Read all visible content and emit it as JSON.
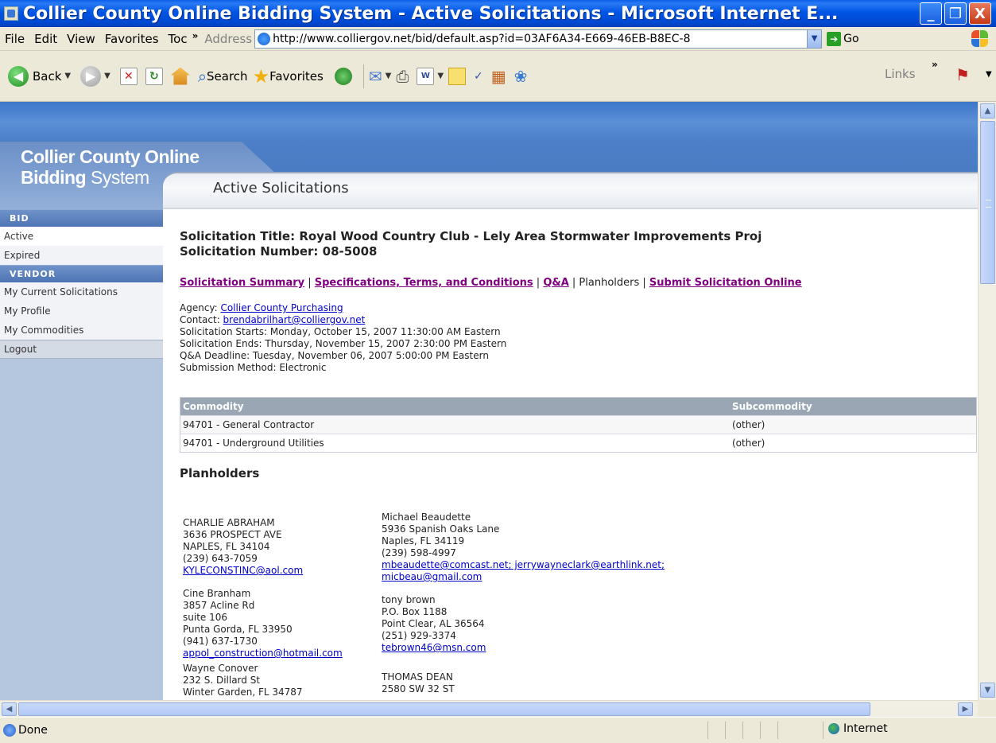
{
  "window": {
    "title": "Collier County Online Bidding System - Active Solicitations - Microsoft Internet E...",
    "min_label": "_",
    "max_label": "❐",
    "close_label": "X"
  },
  "menubar": {
    "items": [
      "File",
      "Edit",
      "View",
      "Favorites",
      "Toc"
    ],
    "chevron": "»",
    "address_label": "Address",
    "address_url": "http://www.colliergov.net/bid/default.asp?id=03AF6A34-E669-46EB-B8EC-8",
    "go_label": "Go"
  },
  "toolbar": {
    "back_label": "Back",
    "search_label": "Search",
    "favorites_label": "Favorites",
    "links_label": "Links",
    "chevron": "»"
  },
  "site": {
    "logo_line1": "Collier County Online",
    "logo_line2_bold": "Bidding",
    "logo_line2_rest": " System",
    "section_title": "Active Solicitations"
  },
  "sidebar": {
    "bid_header": "BID",
    "bid_items": [
      "Active",
      "Expired"
    ],
    "vendor_header": "VENDOR",
    "vendor_items": [
      "My Current Solicitations",
      "My Profile",
      "My Commodities"
    ],
    "logout": "Logout"
  },
  "solicitation": {
    "title_line": "Solicitation Title: Royal Wood Country Club - Lely Area Stormwater Improvements Proj",
    "number_line": "Solicitation Number: 08-5008",
    "nav": {
      "summary": "Solicitation Summary",
      "specs": "Specifications, Terms, and Conditions",
      "qa": "Q&A",
      "planholders": "Planholders",
      "submit": "Submit Solicitation Online",
      "sep": " | "
    },
    "agency_label": "Agency: ",
    "agency": "Collier County Purchasing",
    "contact_label": "Contact: ",
    "contact": "brendabrilhart@colliergov.net",
    "starts": "Solicitation Starts: Monday, October 15, 2007 11:30:00 AM Eastern",
    "ends": "Solicitation Ends: Thursday, November 15, 2007 2:30:00 PM Eastern",
    "qa_deadline": "Q&A Deadline: Tuesday, November 06, 2007 5:00:00 PM Eastern",
    "submission": "Submission Method: Electronic"
  },
  "commodities": {
    "headers": [
      "Commodity",
      "Subcommodity"
    ],
    "rows": [
      [
        "94701 - General Contractor",
        "(other)"
      ],
      [
        "94701 - Underground Utilities",
        "(other)"
      ]
    ]
  },
  "planholders": {
    "heading": "Planholders",
    "col1": [
      {
        "name": "CHARLIE ABRAHAM",
        "addr1": "3636 PROSPECT AVE",
        "addr2": "",
        "city": "NAPLES, FL 34104",
        "phone": "(239) 643-7059",
        "email": "KYLECONSTINC@aol.com"
      },
      {
        "name": "Cine Branham",
        "addr1": "3857 Acline Rd",
        "addr2": "suite 106",
        "city": "Punta Gorda, FL 33950",
        "phone": "(941) 637-1730",
        "email": "appol_construction@hotmail.com"
      },
      {
        "name": "Wayne Conover",
        "addr1": "232 S. Dillard St",
        "addr2": "",
        "city": "Winter Garden, FL 34787",
        "phone": "",
        "email": ""
      }
    ],
    "col2": [
      {
        "name": "Michael Beaudette",
        "addr1": "5936 Spanish Oaks Lane",
        "addr2": "",
        "city": "Naples, FL 34119",
        "phone": "(239) 598-4997",
        "email": "mbeaudette@comcast.net; jerrywayneclark@earthlink.net;",
        "email2": "micbeau@gmail.com"
      },
      {
        "name": "tony brown",
        "addr1": "P.O. Box 1188",
        "addr2": "",
        "city": "Point Clear, AL 36564",
        "phone": "(251) 929-3374",
        "email": "tebrown46@msn.com",
        "email2": ""
      },
      {
        "name": "THOMAS DEAN",
        "addr1": "2580 SW 32 ST",
        "addr2": "",
        "city": "",
        "phone": "",
        "email": "",
        "email2": ""
      }
    ]
  },
  "status": {
    "text": "Done",
    "zone": "Internet"
  }
}
